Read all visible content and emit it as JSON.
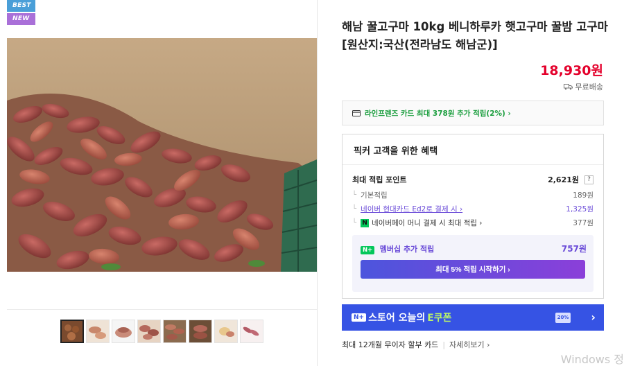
{
  "badges": {
    "best": "BEST",
    "new": "NEW"
  },
  "product": {
    "title": "해남 꿀고구마 10kg 베니하루카 햇고구마 꿀밤 고구마 [원산지:국산(전라남도 해남군)]",
    "price": "18,930원",
    "delivery": "무료배송"
  },
  "card_promo": {
    "text": "라인프렌즈 카드 최대 378원 추가 적립(2%) ›"
  },
  "benefits": {
    "title": "픽커 고객을 위한 혜택",
    "max_points_label": "최대 적립 포인트",
    "max_points_value": "2,621원",
    "help": "?",
    "rows": [
      {
        "label": "기본적립",
        "value": "189원"
      },
      {
        "label": "네이버 현대카드 Ed2로 결제 시 ›",
        "value": "1,325원"
      },
      {
        "label": "네이버페이 머니 결제 시 최대 적립 ›",
        "value": "377원"
      }
    ],
    "membership": {
      "badge": "N+",
      "label": "멤버십 추가 적립",
      "value": "757원",
      "button": "최대 5% 적립 시작하기 ›"
    }
  },
  "coupon_banner": {
    "badge": "N+",
    "prefix": "스토어 오늘의",
    "highlight": "E쿠폰",
    "ticket": "20%",
    "chevron": "›"
  },
  "installment": {
    "label": "최대 12개월 무이자 할부 카드",
    "divider": "|",
    "detail": "자세히보기 ›"
  },
  "watermark": "Windows 정",
  "icons": {
    "delivery": "truck-icon",
    "card": "credit-card-icon",
    "npay": "npay-icon",
    "coupon": "coupon-ticket-icon",
    "chevron": "chevron-right-icon"
  },
  "colors": {
    "price": "#e4002b",
    "card_promo": "#1b9e3e",
    "membership": "#6a4bd8",
    "coupon_banner": "#3653e4",
    "npay_green": "#03c75a"
  }
}
